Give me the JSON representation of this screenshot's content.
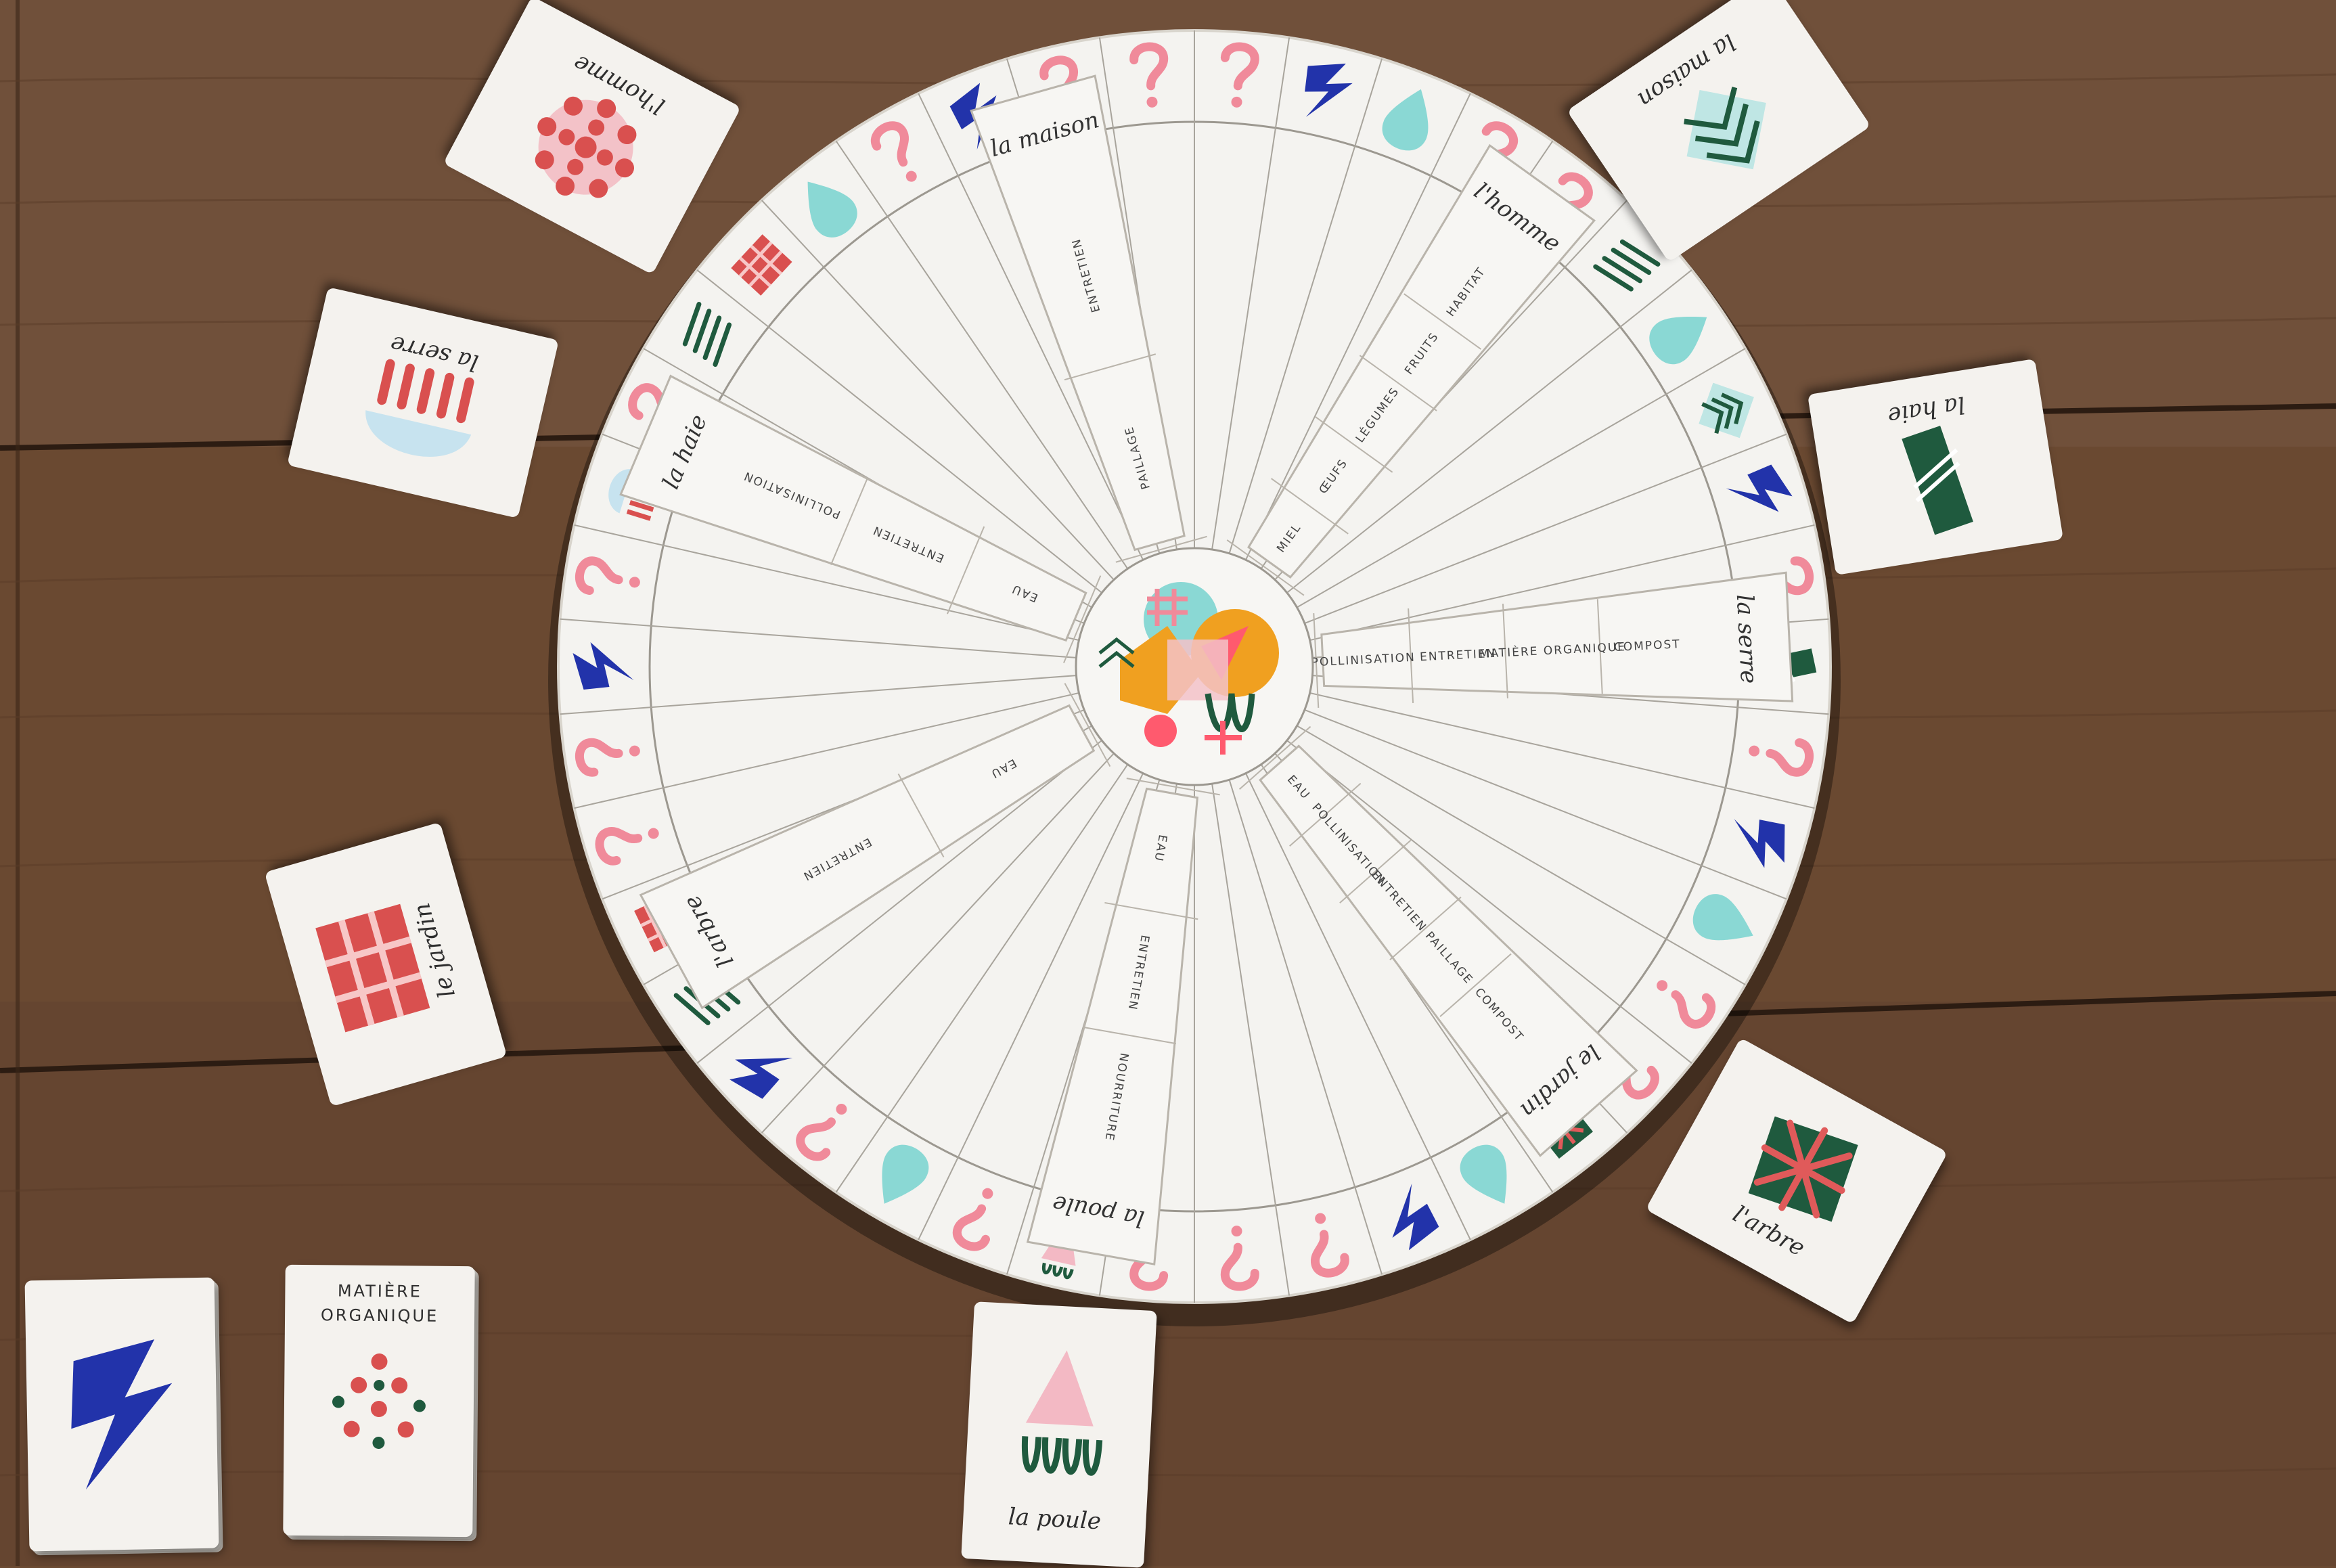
{
  "board": {
    "sectors": [
      {
        "label": "la poule",
        "resources": [
          "NOURRITURE",
          "ENTRETIEN",
          "EAU"
        ]
      },
      {
        "label": "l'arbre",
        "resources": [
          "ENTRETIEN",
          "EAU"
        ]
      },
      {
        "label": "la haie",
        "resources": [
          "POLLINISATION",
          "ENTRETIEN",
          "EAU"
        ]
      },
      {
        "label": "la maison",
        "resources": [
          "ENTRETIEN",
          "PAILLAGE"
        ]
      },
      {
        "label": "l'homme",
        "resources": [
          "HABITAT",
          "FRUITS",
          "LÉGUMES",
          "ŒUFS",
          "MIEL"
        ]
      },
      {
        "label": "la serre",
        "resources": [
          "COMPOST",
          "MATIÈRE ORGANIQUE",
          "ENTRETIEN",
          "POLLINISATION"
        ]
      },
      {
        "label": "le jardin",
        "resources": [
          "COMPOST",
          "PAILLAGE",
          "ENTRETIEN",
          "POLLINISATION",
          "EAU"
        ]
      }
    ],
    "rim_symbols": [
      "question",
      "lightning",
      "drop",
      "question",
      "question",
      "lines",
      "drop",
      "chevron",
      "lightning",
      "question",
      "bar",
      "question",
      "lightning",
      "drop",
      "question",
      "question",
      "gift",
      "drop",
      "lightning",
      "question",
      "question",
      "question",
      "hen",
      "question",
      "drop",
      "question",
      "lightning",
      "lines",
      "grid",
      "question",
      "question",
      "lightning",
      "question",
      "dome",
      "question",
      "lines",
      "grid",
      "drop",
      "question",
      "lightning",
      "question",
      "question"
    ]
  },
  "cards": {
    "homme": {
      "label": "l'homme"
    },
    "serre": {
      "label": "la serre"
    },
    "maison": {
      "label": "la maison"
    },
    "haie": {
      "label": "la haie"
    },
    "jardin": {
      "label": "le jardin"
    },
    "arbre": {
      "label": "l'arbre"
    },
    "poule": {
      "label": "la poule"
    },
    "matiere": {
      "label": "MATIÈRE ORGANIQUE"
    }
  },
  "colors": {
    "table": "#6b4a32",
    "paper": "#f4f2ee",
    "pink": "#f08a9a",
    "neon": "#ff5a6e",
    "blue": "#2233aa",
    "aqua": "#8ad8d4",
    "green": "#1f5a3e",
    "red": "#d9504f",
    "orange": "#f0a020"
  }
}
